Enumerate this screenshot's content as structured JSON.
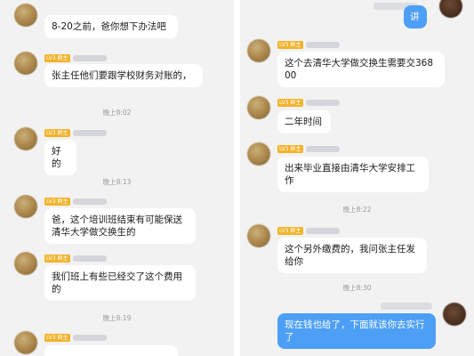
{
  "left": {
    "messages": [
      {
        "text": "8-20之前，爸你想下办法吧"
      },
      {
        "badge": "LV3 群主",
        "text": "张主任他们要跟学校财务对账的，"
      },
      {
        "badge": "LV3 群主",
        "text": "好的"
      },
      {
        "badge": "LV3 群主",
        "text": "爸，这个培训班结束有可能保送清华大学做交换生的"
      },
      {
        "badge": "LV3 群主",
        "text": "我们班上有些已经交了这个费用的"
      },
      {
        "badge": "LV3 群主"
      }
    ],
    "times": [
      "晚上8:02",
      "晚上8:13",
      "晚上8:19"
    ]
  },
  "right": {
    "messages": [
      {
        "text": "讲",
        "me": true
      },
      {
        "badge": "LV3 群主",
        "text": "这个去清华大学做交换生需要交36800"
      },
      {
        "badge": "LV3 群主",
        "text": "二年时间"
      },
      {
        "badge": "LV3 群主",
        "text": "出来毕业直接由清华大学安排工作"
      },
      {
        "badge": "LV3 群主",
        "text": "这个另外缴费的，我问张主任发给你"
      },
      {
        "text": "现在钱也给了，下面就该你去实行了",
        "me": true
      }
    ],
    "times": [
      "晚上8:22",
      "晚上8:30"
    ]
  }
}
